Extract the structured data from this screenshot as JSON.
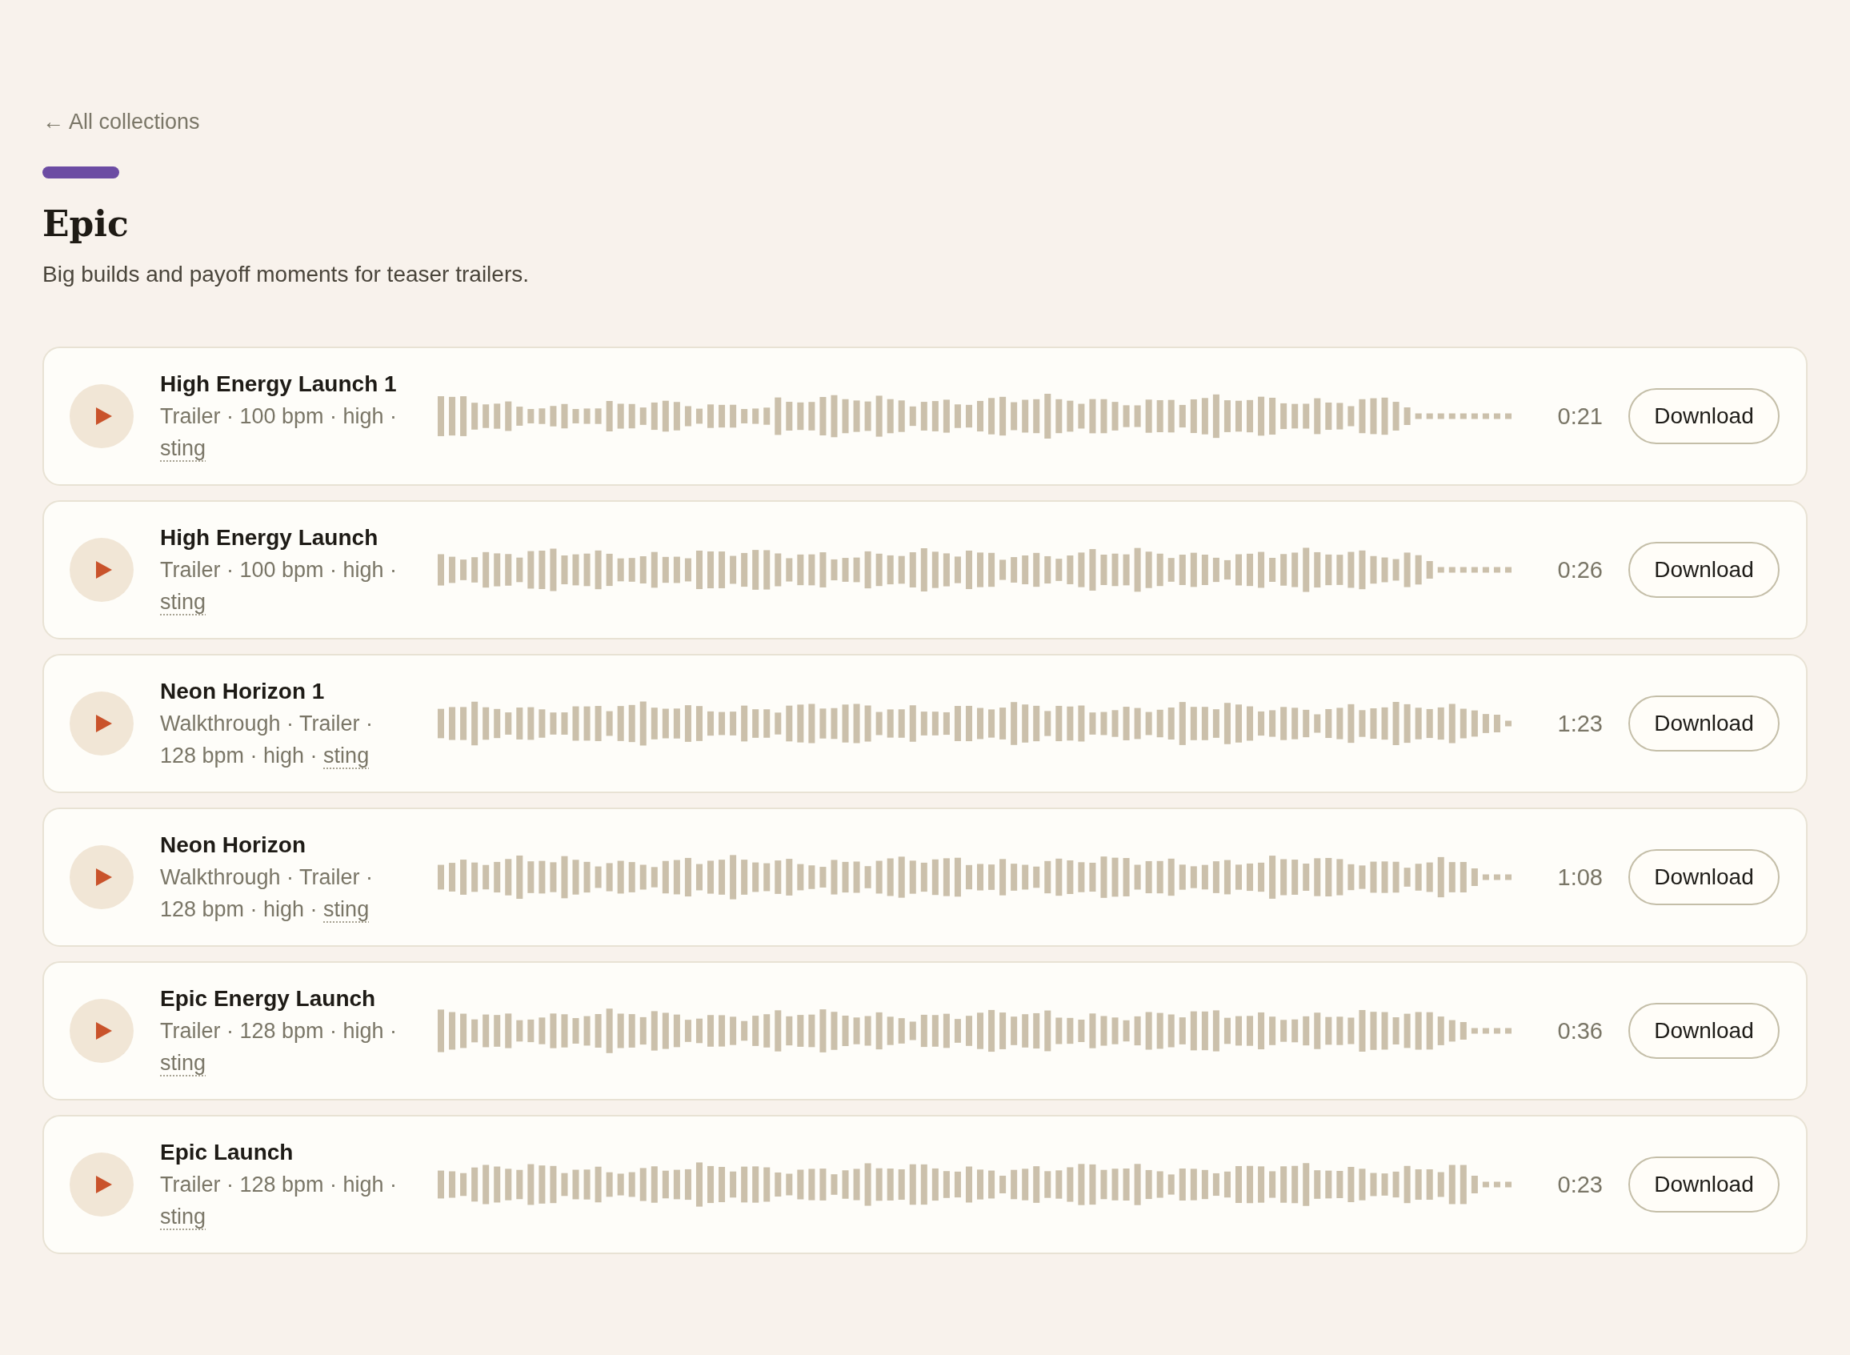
{
  "back_link": {
    "label": "← All collections"
  },
  "collection": {
    "title": "Epic",
    "description": "Big builds and payoff moments for teaser trailers."
  },
  "tracks": [
    {
      "title": "High Energy Launch 1",
      "meta": "Trailer · 100 bpm · high ·",
      "tag": "sting",
      "duration": "0:21",
      "action": "Download"
    },
    {
      "title": "High Energy Launch",
      "meta": "Trailer · 100 bpm · high ·",
      "tag": "sting",
      "duration": "0:26",
      "action": "Download"
    },
    {
      "title": "Neon Horizon 1",
      "meta": "Walkthrough · Trailer · 128 bpm · high ·",
      "tag": "sting",
      "duration": "1:23",
      "action": "Download"
    },
    {
      "title": "Neon Horizon",
      "meta": "Walkthrough · Trailer · 128 bpm · high ·",
      "tag": "sting",
      "duration": "1:08",
      "action": "Download"
    },
    {
      "title": "Epic Energy Launch",
      "meta": "Trailer · 128 bpm · high ·",
      "tag": "sting",
      "duration": "0:36",
      "action": "Download"
    },
    {
      "title": "Epic Launch",
      "meta": "Trailer · 128 bpm · high ·",
      "tag": "sting",
      "duration": "0:23",
      "action": "Download"
    }
  ]
}
